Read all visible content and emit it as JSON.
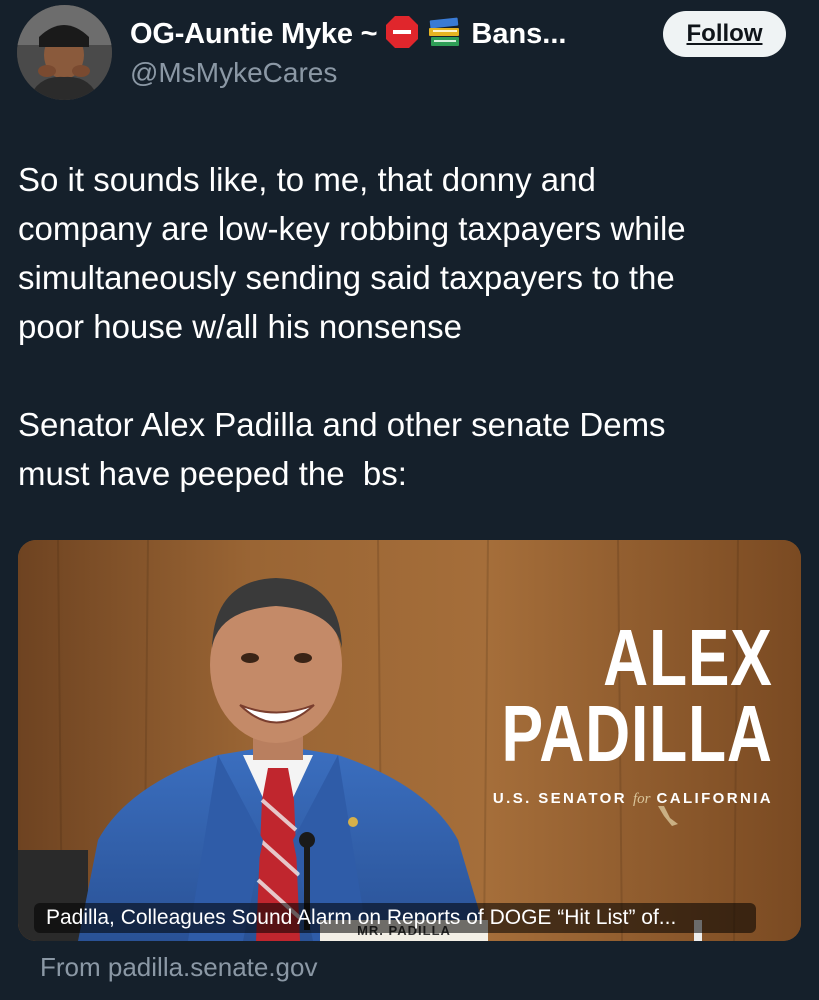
{
  "author": {
    "display_name": "OG-Auntie Myke ~",
    "display_name_tail": "Bans...",
    "handle": "@MsMykeCares",
    "name_emojis": [
      "stop-sign-icon",
      "books-icon"
    ]
  },
  "follow_button": {
    "label": "Follow"
  },
  "tweet": {
    "text": "So it sounds like, to me, that donny and\ncompany are low-key robbing taxpayers while\nsimultaneously sending said taxpayers to the\npoor house w/all his nonsense\n\nSenator Alex Padilla and other senate Dems\nmust have peeped the  bs:"
  },
  "media_card": {
    "brand_line1": "ALEX",
    "brand_line2": "PADILLA",
    "brand_sub_left": "U.S. SENATOR",
    "brand_sub_for": "for",
    "brand_sub_right": "CALIFORNIA",
    "nameplate": "MR. PADILLA",
    "caption": "Padilla, Colleagues Sound Alarm on Reports of DOGE “Hit List” of..."
  },
  "link_source": "From padilla.senate.gov",
  "colors": {
    "background": "#15202b",
    "text": "#ffffff",
    "secondary_text": "#8b98a5",
    "follow_bg": "#eff3f4"
  }
}
